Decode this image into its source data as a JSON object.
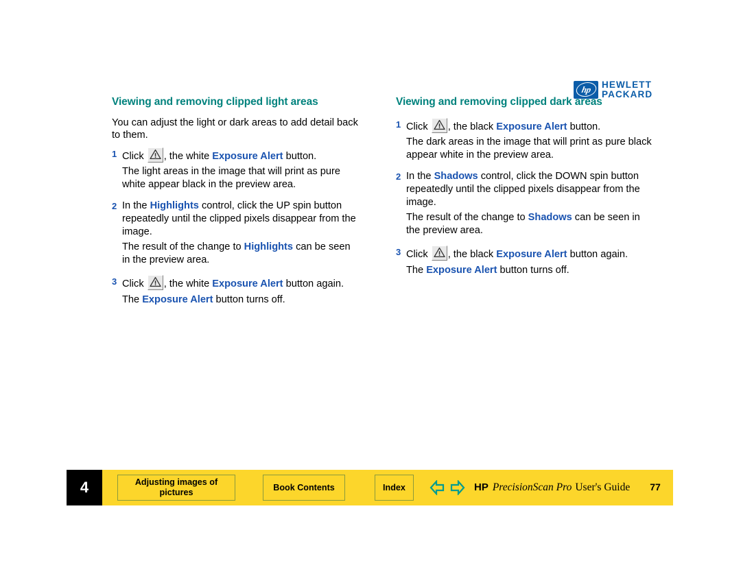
{
  "brand": {
    "logo_mark_text": "hp",
    "logo_line1": "HEWLETT",
    "logo_line2": "PACKARD",
    "logo_color": "#0b5ca8"
  },
  "colors": {
    "heading_teal": "#00827d",
    "link_blue": "#1a53b0",
    "footer_yellow": "#fcd62b",
    "footer_border_green": "#8a9a3c",
    "arrow_teal": "#009b8f"
  },
  "left_column": {
    "heading": "Viewing and removing clipped light areas",
    "intro": "You can adjust the light or dark areas to add detail back to them.",
    "steps": [
      {
        "num": "1",
        "parts": [
          {
            "type": "text",
            "value": "Click "
          },
          {
            "type": "icon",
            "value": "warning-alert-icon"
          },
          {
            "type": "text",
            "value": ", the white "
          },
          {
            "type": "link",
            "value": "Exposure Alert"
          },
          {
            "type": "text",
            "value": " button."
          }
        ],
        "detail": "The light areas in the image that will print as pure white appear black in the preview area."
      },
      {
        "num": "2",
        "parts": [
          {
            "type": "text",
            "value": "In the "
          },
          {
            "type": "link",
            "value": "Highlights"
          },
          {
            "type": "text",
            "value": " control, click the UP spin button repeatedly until the clipped pixels disappear from the image."
          }
        ],
        "detail_parts": [
          {
            "type": "text",
            "value": "The result of the change to "
          },
          {
            "type": "link",
            "value": "Highlights"
          },
          {
            "type": "text",
            "value": " can be seen in the preview area."
          }
        ]
      },
      {
        "num": "3",
        "parts": [
          {
            "type": "text",
            "value": "Click "
          },
          {
            "type": "icon",
            "value": "warning-alert-icon"
          },
          {
            "type": "text",
            "value": ", the white "
          },
          {
            "type": "link",
            "value": "Exposure Alert"
          },
          {
            "type": "text",
            "value": " button again."
          }
        ],
        "detail_parts": [
          {
            "type": "text",
            "value": "The "
          },
          {
            "type": "link",
            "value": "Exposure Alert"
          },
          {
            "type": "text",
            "value": " button turns off."
          }
        ]
      }
    ]
  },
  "right_column": {
    "heading": "Viewing and removing clipped dark areas",
    "steps": [
      {
        "num": "1",
        "parts": [
          {
            "type": "text",
            "value": "Click "
          },
          {
            "type": "icon",
            "value": "warning-alert-icon"
          },
          {
            "type": "text",
            "value": ", the black "
          },
          {
            "type": "link",
            "value": "Exposure Alert"
          },
          {
            "type": "text",
            "value": " button."
          }
        ],
        "detail": "The dark areas in the image that will print as pure black appear white in the preview area."
      },
      {
        "num": "2",
        "parts": [
          {
            "type": "text",
            "value": "In the "
          },
          {
            "type": "link",
            "value": "Shadows"
          },
          {
            "type": "text",
            "value": " control, click the DOWN spin button repeatedly until the clipped pixels disappear from the image."
          }
        ],
        "detail_parts": [
          {
            "type": "text",
            "value": "The result of the change to "
          },
          {
            "type": "link",
            "value": "Shadows"
          },
          {
            "type": "text",
            "value": " can be seen in the preview area."
          }
        ]
      },
      {
        "num": "3",
        "parts": [
          {
            "type": "text",
            "value": "Click "
          },
          {
            "type": "icon",
            "value": "warning-alert-icon"
          },
          {
            "type": "text",
            "value": ", the black "
          },
          {
            "type": "link",
            "value": "Exposure Alert"
          },
          {
            "type": "text",
            "value": " button again."
          }
        ],
        "detail_parts": [
          {
            "type": "text",
            "value": "The "
          },
          {
            "type": "link",
            "value": "Exposure Alert"
          },
          {
            "type": "text",
            "value": " button turns off."
          }
        ]
      }
    ]
  },
  "footer": {
    "chapter_number": "4",
    "chapter_button": "Adjusting images of pictures",
    "book_contents_button": "Book Contents",
    "index_button": "Index",
    "prev_icon": "left-arrow-icon",
    "next_icon": "right-arrow-icon",
    "title_hp": "HP",
    "title_product": "PrecisionScan Pro",
    "title_guide": "User's Guide",
    "page_number": "77"
  }
}
